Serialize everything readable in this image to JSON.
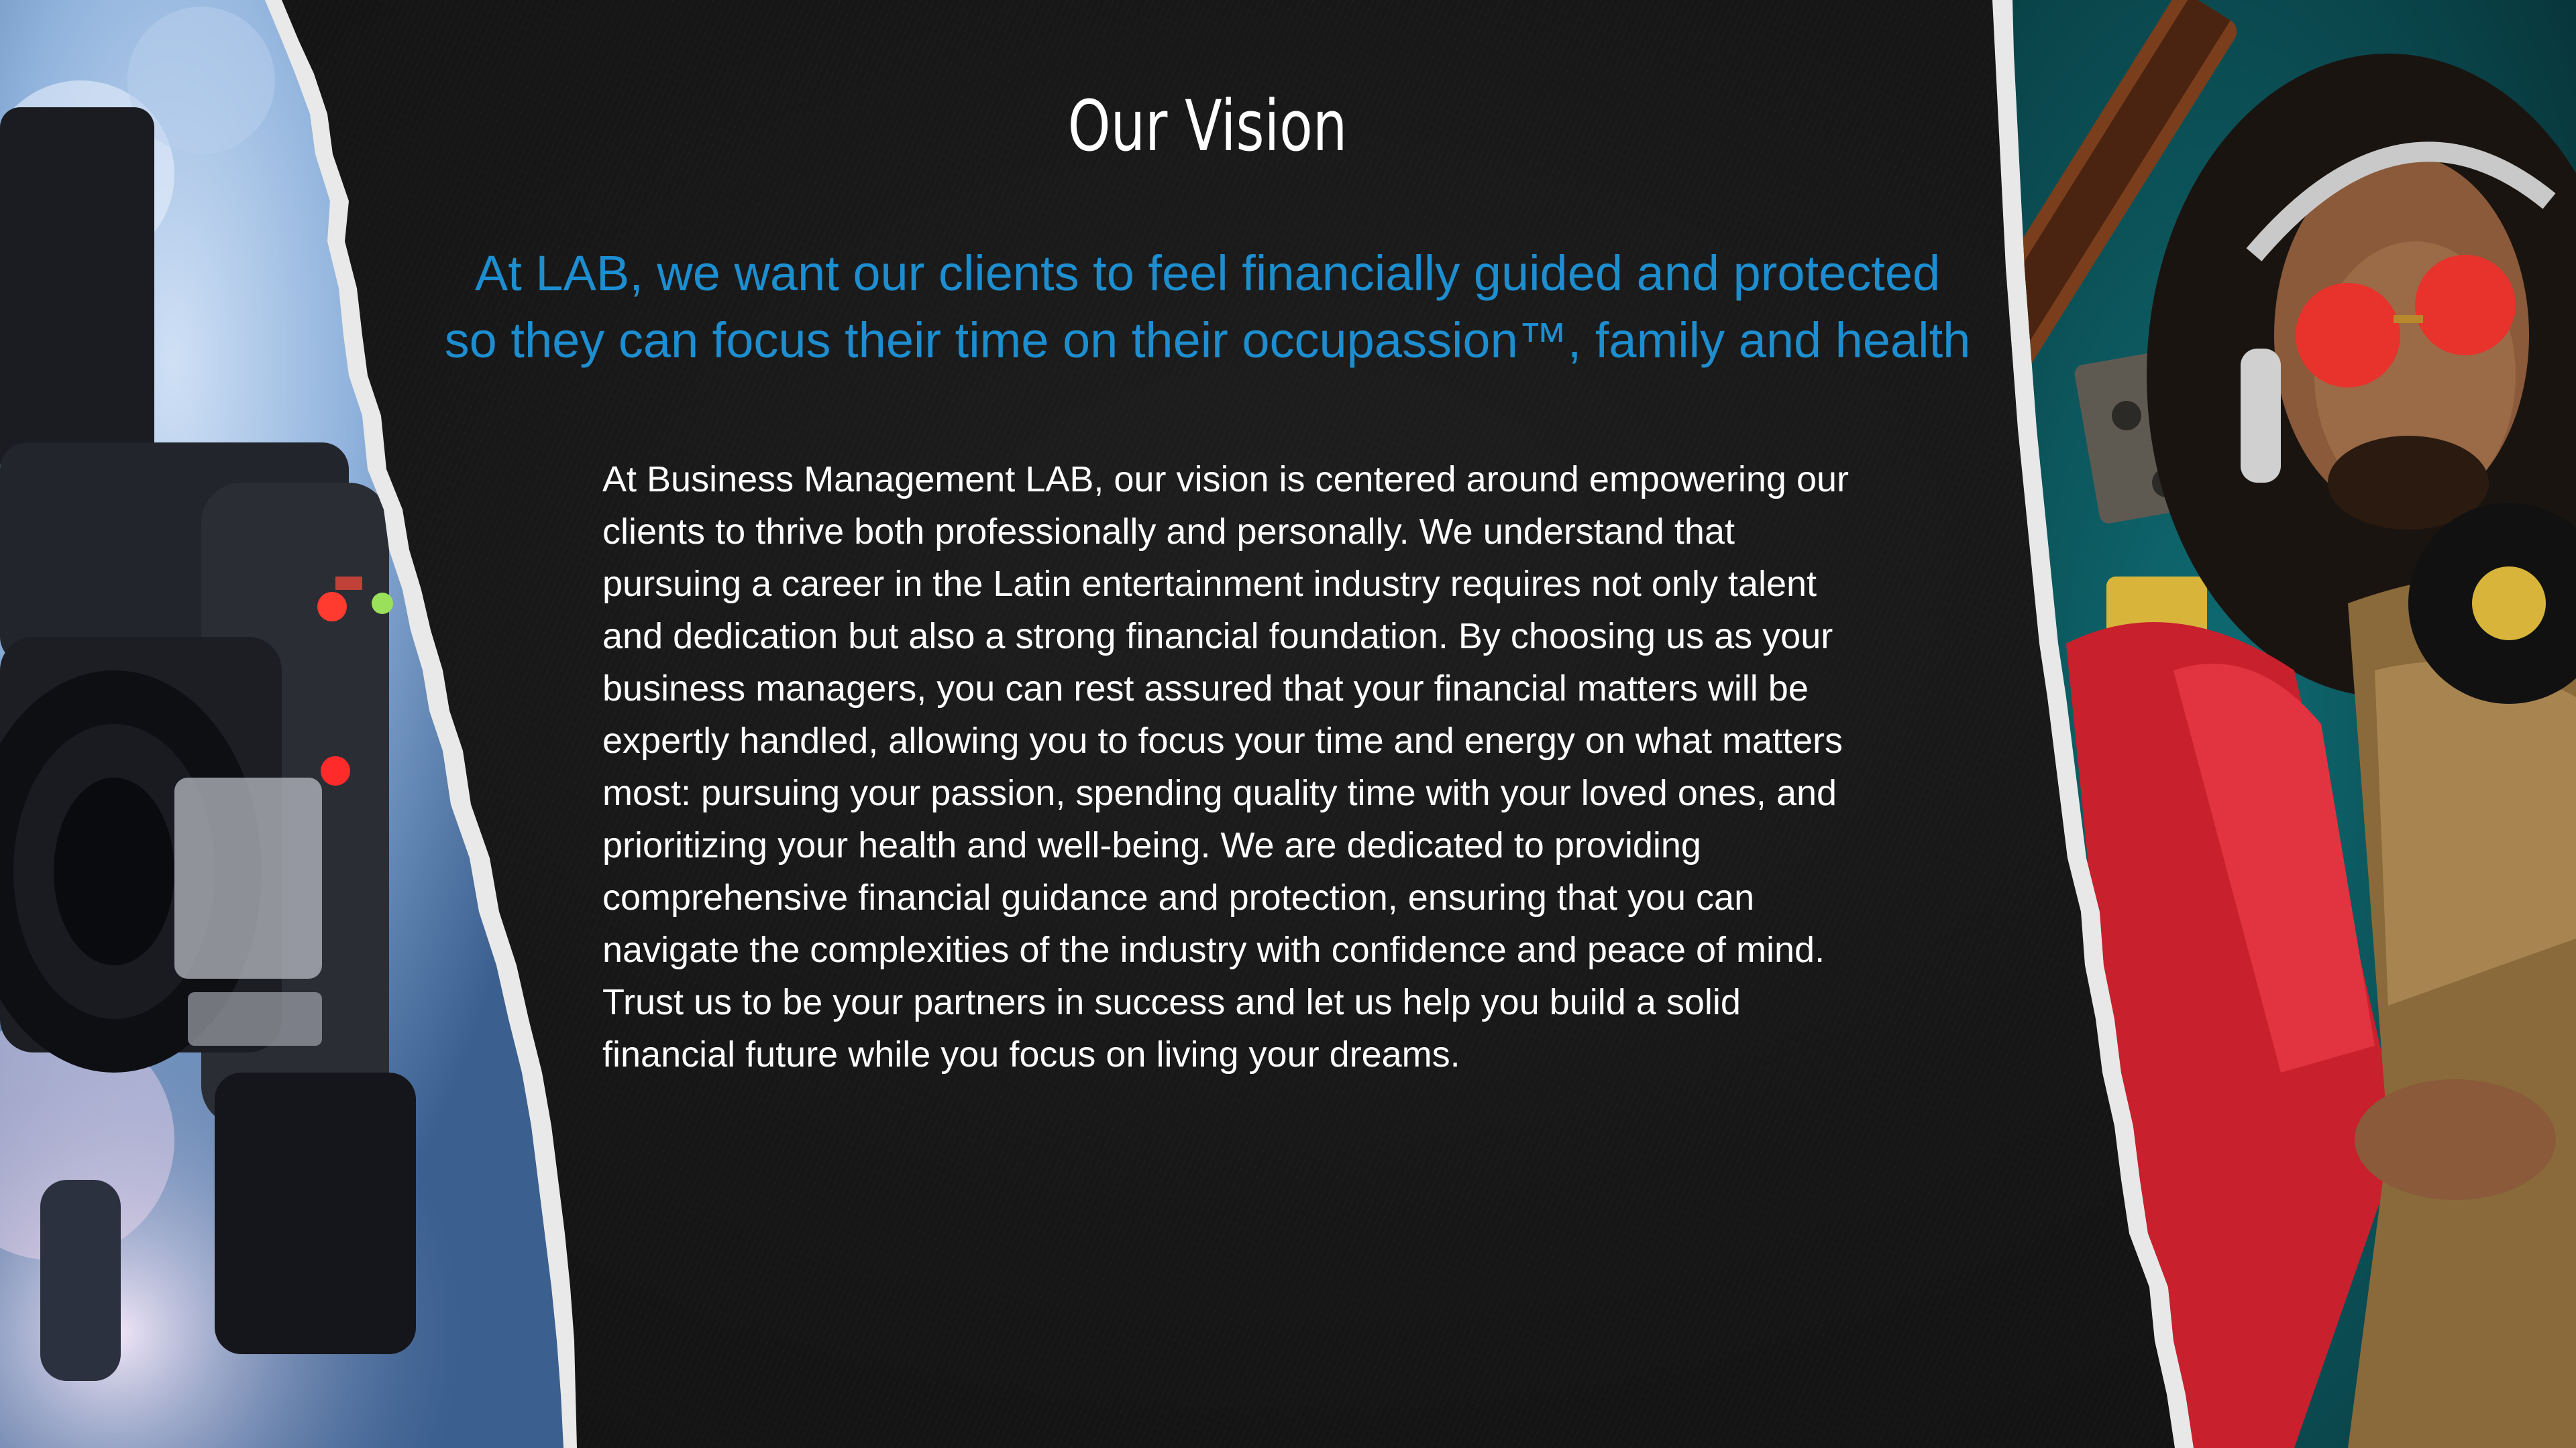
{
  "slide": {
    "title": "Our Vision",
    "subtitle_line1": "At LAB, we want our clients to feel financially guided and protected",
    "subtitle_line2": "so they can focus their time on their occupassion™, family and health",
    "body": "At Business Management LAB, our vision is centered around empowering our clients to thrive both professionally and personally. We understand that pursuing a career in the Latin entertainment industry requires not only talent and dedication but also a strong financial foundation. By choosing us as your business managers, you can rest assured that your financial matters will be expertly handled, allowing you to focus your time and energy on what matters most: pursuing your passion, spending quality time with your loved ones, and prioritizing your health and well-being. We are dedicated to providing comprehensive financial guidance and protection, ensuring that you can navigate the complexities of the industry with confidence and peace of mind. Trust us to be your partners in success and let us help you build a solid financial future while you focus on living your dreams."
  },
  "colors": {
    "background": "#151515",
    "title": "#ffffff",
    "subtitle": "#1d8ed0",
    "body": "#ffffff"
  },
  "images": {
    "left": "camera-photo",
    "right": "musician-photo"
  }
}
